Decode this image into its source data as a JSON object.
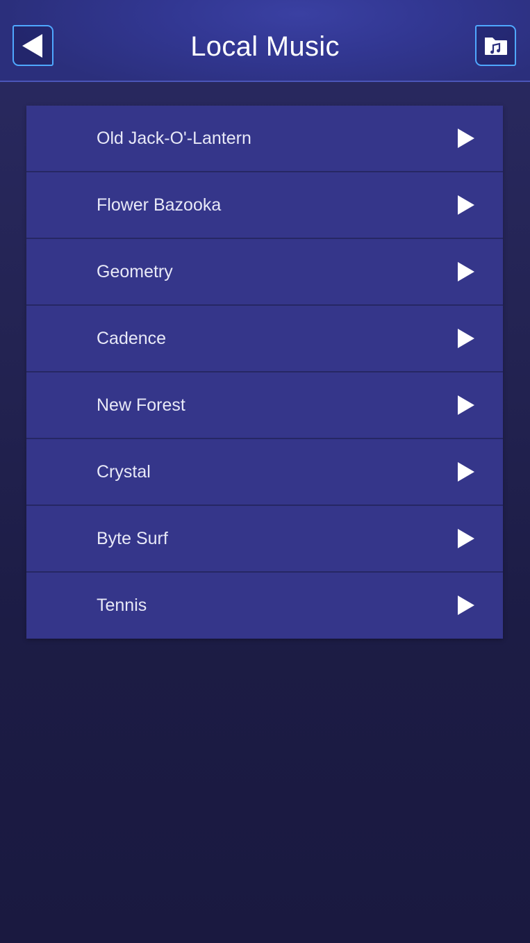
{
  "header": {
    "title": "Local Music",
    "back_icon": "back-arrow-icon",
    "folder_icon": "music-folder-icon"
  },
  "tracks": [
    {
      "label": "Old Jack-O'-Lantern"
    },
    {
      "label": "Flower Bazooka"
    },
    {
      "label": "Geometry"
    },
    {
      "label": "Cadence"
    },
    {
      "label": "New Forest"
    },
    {
      "label": "Crystal"
    },
    {
      "label": "Byte Surf"
    },
    {
      "label": "Tennis"
    }
  ],
  "row_icon": "play-icon",
  "colors": {
    "accent_border": "#4fa8ff",
    "list_background": "#35368a",
    "header_background": "#323792",
    "page_background": "#1c1c45"
  }
}
